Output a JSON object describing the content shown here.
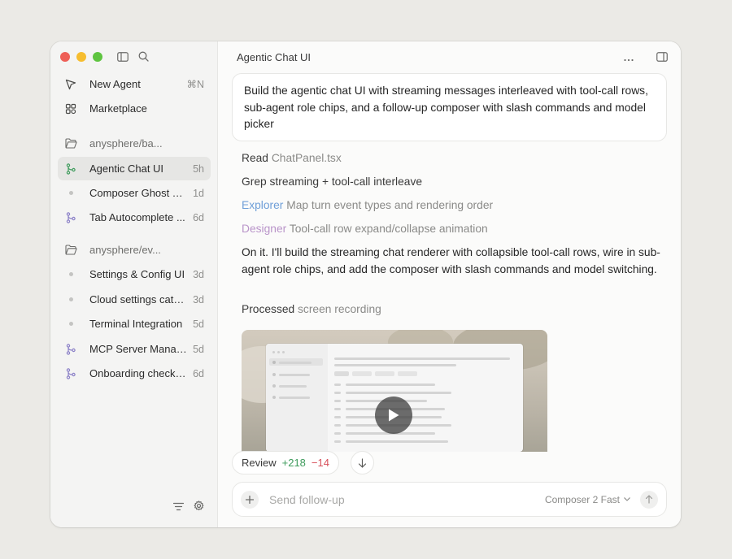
{
  "window": {
    "title": "Agentic Chat UI"
  },
  "sidebar": {
    "new_agent": {
      "label": "New Agent",
      "shortcut": "⌘N"
    },
    "marketplace": {
      "label": "Marketplace"
    },
    "groups": [
      {
        "name": "anysphere/ba...",
        "items": [
          {
            "label": "Agentic Chat UI",
            "age": "5h",
            "icon": "branch-icon",
            "active": true
          },
          {
            "label": "Composer Ghost Te...",
            "age": "1d",
            "icon": "dot"
          },
          {
            "label": "Tab Autocomplete ...",
            "age": "6d",
            "icon": "branch-icon"
          }
        ]
      },
      {
        "name": "anysphere/ev...",
        "items": [
          {
            "label": "Settings & Config UI",
            "age": "3d",
            "icon": "dot"
          },
          {
            "label": "Cloud settings cata...",
            "age": "3d",
            "icon": "dot"
          },
          {
            "label": "Terminal Integration",
            "age": "5d",
            "icon": "dot"
          },
          {
            "label": "MCP Server Manager",
            "age": "5d",
            "icon": "branch-icon"
          },
          {
            "label": "Onboarding checkli...",
            "age": "6d",
            "icon": "branch-icon"
          }
        ]
      }
    ]
  },
  "chat": {
    "prompt": "Build the agentic chat UI with streaming messages interleaved with tool-call rows, sub-agent role chips, and a follow-up composer with slash commands and model picker",
    "steps": [
      {
        "verb": "Read",
        "detail": "ChatPanel.tsx"
      },
      {
        "verb": "Grep",
        "detail": "streaming + tool-call interleave"
      },
      {
        "role": "Explorer",
        "detail": "Map turn event types and rendering order"
      },
      {
        "role": "Designer",
        "detail": "Tool-call row expand/collapse animation"
      }
    ],
    "reply": "On it. I'll build the streaming chat renderer with collapsible tool-call rows, wire in sub-agent role chips, and add the composer with slash commands and model switching.",
    "processed": {
      "verb": "Processed",
      "detail": "screen recording"
    }
  },
  "review": {
    "label": "Review",
    "additions": "+218",
    "deletions": "−14"
  },
  "composer": {
    "placeholder": "Send follow-up",
    "model": "Composer 2 Fast"
  },
  "colors": {
    "explorer": "#6f9fd8",
    "designer": "#b994c9",
    "additions": "#3f9c5d",
    "deletions": "#d8505b",
    "branch_active": "#3f9c5d",
    "branch": "#8a7fc7"
  }
}
